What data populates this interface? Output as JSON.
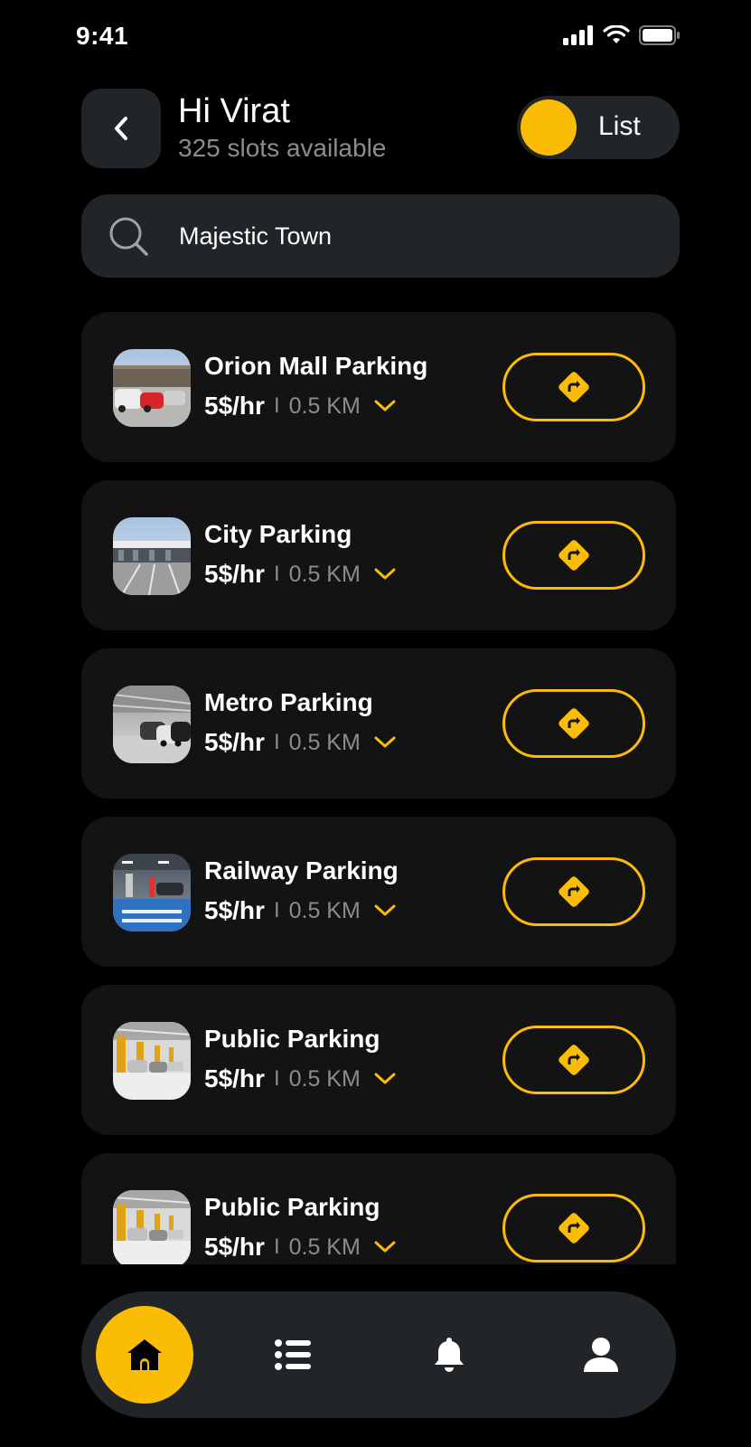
{
  "status_bar": {
    "time": "9:41"
  },
  "header": {
    "greeting": "Hi Virat",
    "slots_text": "325 slots available",
    "toggle_label": "List"
  },
  "search": {
    "value": "Majestic Town"
  },
  "parkings": [
    {
      "name": "Orion Mall Parking",
      "price": "5$/hr",
      "separator": "I",
      "distance": "0.5 KM",
      "photo": "mall-lot"
    },
    {
      "name": "City Parking",
      "price": "5$/hr",
      "separator": "I",
      "distance": "0.5 KM",
      "photo": "open-lot"
    },
    {
      "name": "Metro Parking",
      "price": "5$/hr",
      "separator": "I",
      "distance": "0.5 KM",
      "photo": "indoor-garage"
    },
    {
      "name": "Railway Parking",
      "price": "5$/hr",
      "separator": "I",
      "distance": "0.5 KM",
      "photo": "blue-floor-garage"
    },
    {
      "name": "Public Parking",
      "price": "5$/hr",
      "separator": "I",
      "distance": "0.5 KM",
      "photo": "yellow-pillar-garage"
    },
    {
      "name": "Public Parking",
      "price": "5$/hr",
      "separator": "I",
      "distance": "0.5 KM",
      "photo": "yellow-pillar-garage"
    }
  ],
  "bottom_nav": {
    "items": [
      {
        "icon": "home-icon",
        "active": true
      },
      {
        "icon": "list-icon",
        "active": false
      },
      {
        "icon": "bell-icon",
        "active": false
      },
      {
        "icon": "user-icon",
        "active": false
      }
    ]
  },
  "colors": {
    "accent": "#fbbc05",
    "surface": "#212527",
    "card": "#131313",
    "muted": "#8a8d90",
    "background": "#000000"
  }
}
